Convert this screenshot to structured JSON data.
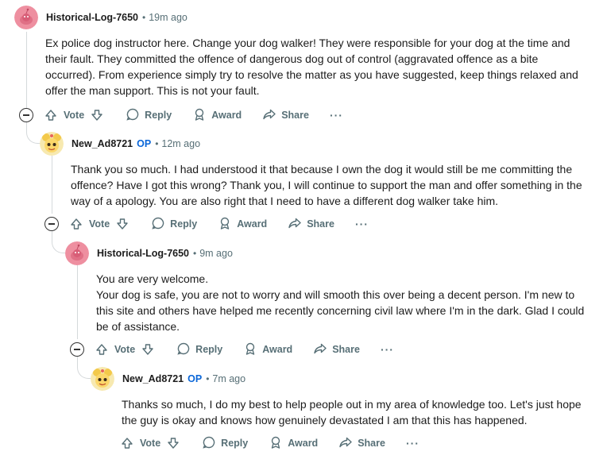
{
  "thread": {
    "comments": [
      {
        "author": "Historical-Log-7650",
        "is_op": false,
        "op_label": "",
        "separator": "•",
        "time": "19m ago",
        "avatar": "snoo-avatar-pink",
        "paragraphs": [
          "Ex police dog instructor here. Change your dog walker! They were responsible for your dog at the time and their fault. They committed the offence of dangerous dog out of control (aggravated offence as a bite occurred). From experience simply try to resolve the matter as you have suggested, keep things relaxed and offer the man support. This is not your fault."
        ]
      },
      {
        "author": "New_Ad8721",
        "is_op": true,
        "op_label": "OP",
        "separator": "•",
        "time": "12m ago",
        "avatar": "cartoon-avatar-yellow",
        "paragraphs": [
          "Thank you so much. I had understood it that because I own the dog it would still be me committing the offence? Have I got this wrong? Thank you, I will continue to support the man and offer something in the way of a apology. You are also right that I need to have a different dog walker take him."
        ]
      },
      {
        "author": "Historical-Log-7650",
        "is_op": false,
        "op_label": "",
        "separator": "•",
        "time": "9m ago",
        "avatar": "snoo-avatar-pink",
        "paragraphs": [
          "You are very welcome.",
          "Your dog is safe, you are not to worry and will smooth this over being a decent person. I'm new to this site and others have helped me recently concerning civil law where I'm in the dark. Glad I could be of assistance."
        ]
      },
      {
        "author": "New_Ad8721",
        "is_op": true,
        "op_label": "OP",
        "separator": "•",
        "time": "7m ago",
        "avatar": "cartoon-avatar-yellow",
        "paragraphs": [
          "Thanks so much, I do my best to help people out in my area of knowledge too. Let's just hope the guy is okay and knows how genuinely devastated I am that this has happened."
        ]
      }
    ],
    "actions": {
      "vote": "Vote",
      "reply": "Reply",
      "award": "Award",
      "share": "Share",
      "more": "···"
    }
  }
}
